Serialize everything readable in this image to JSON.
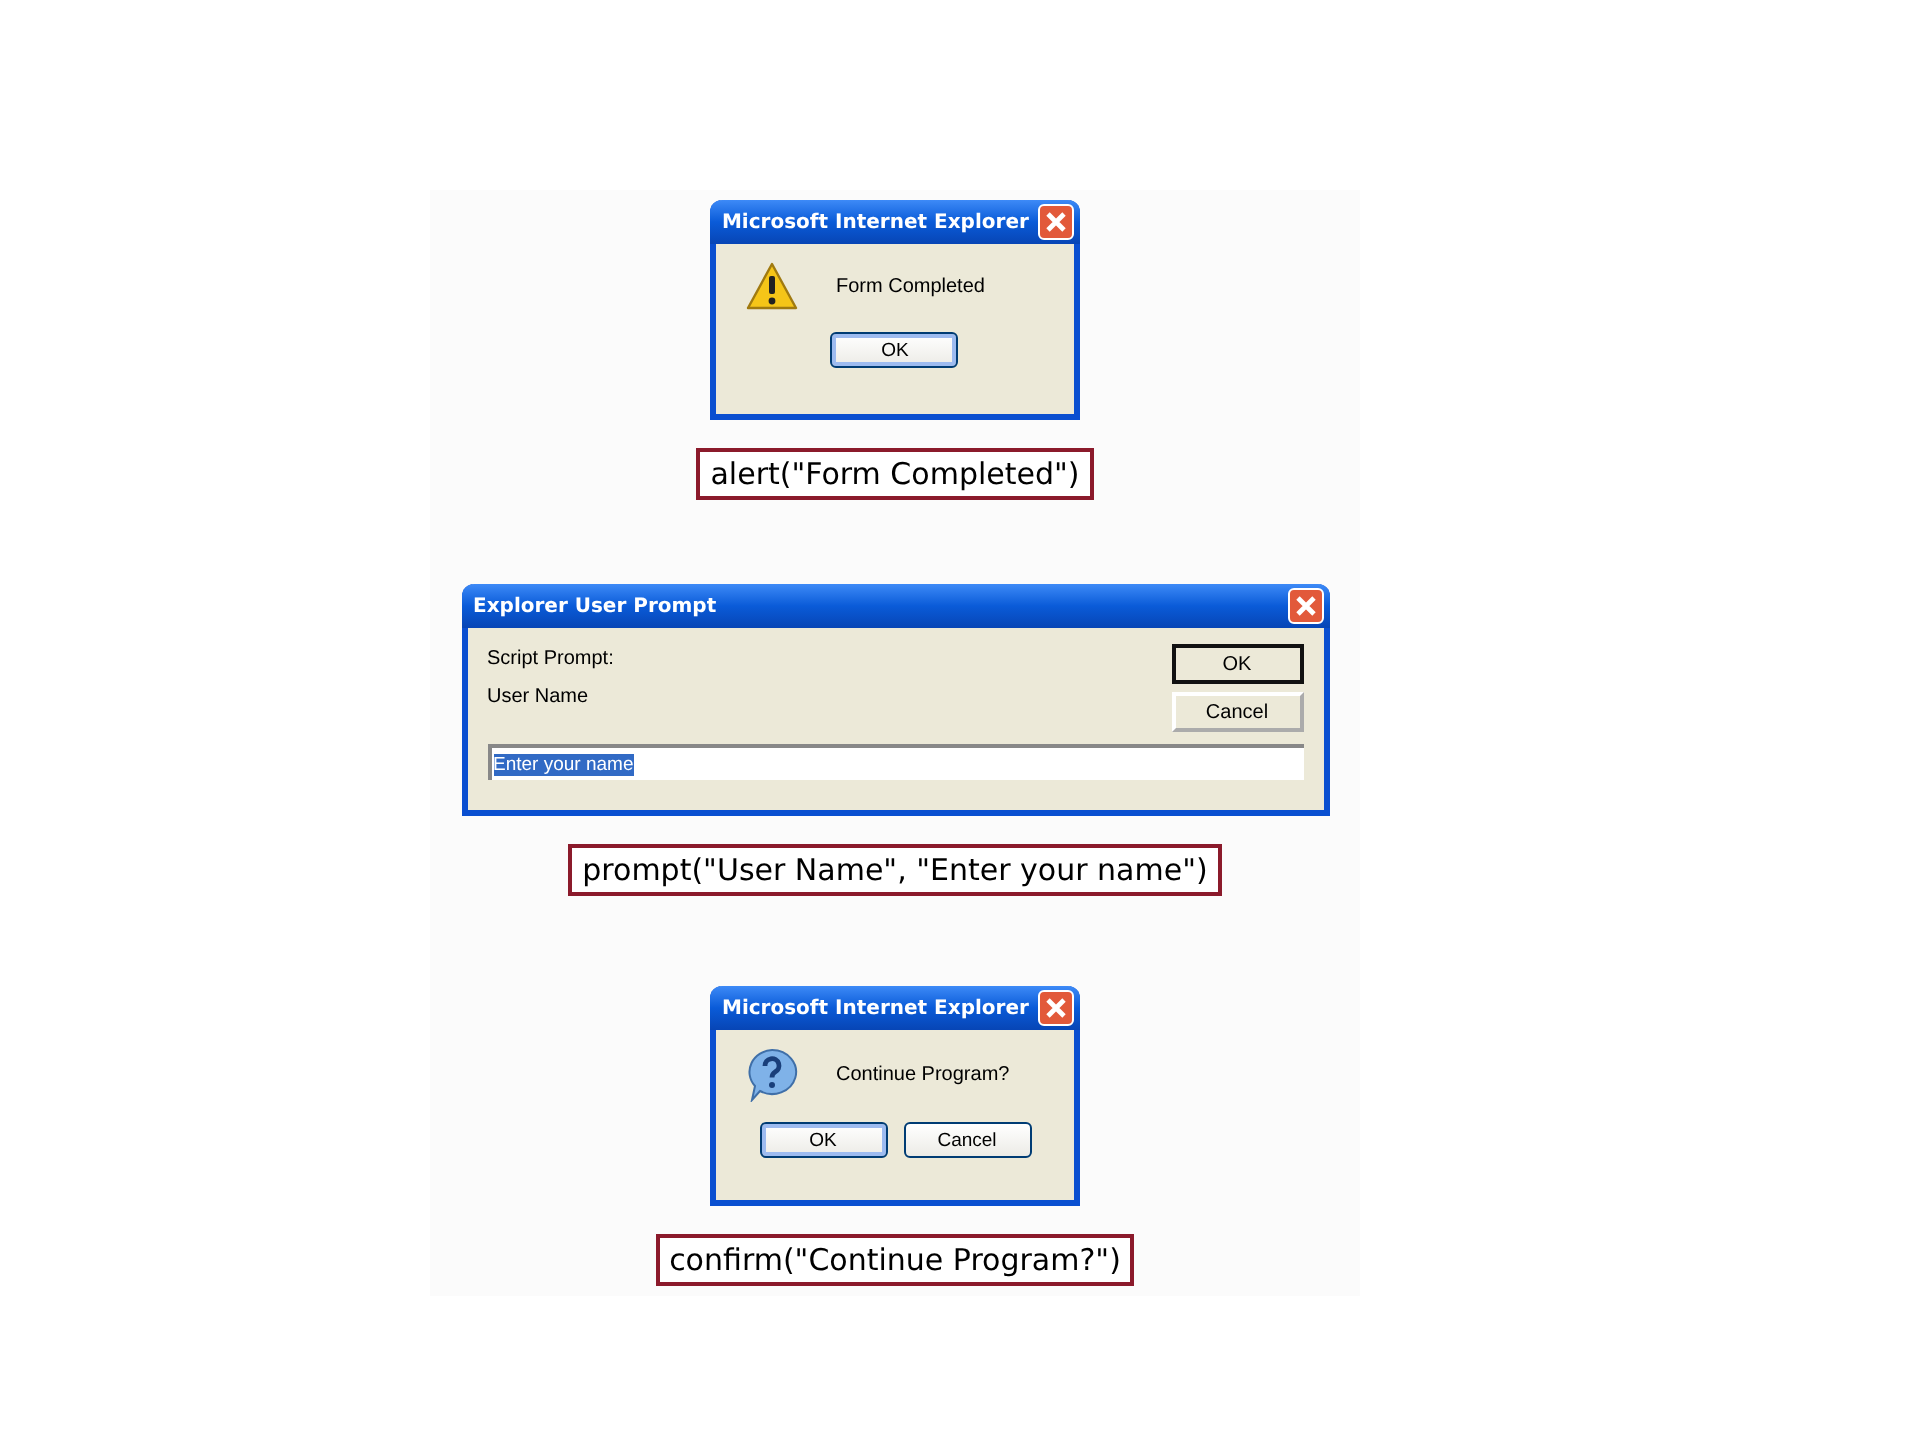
{
  "dialogs": [
    {
      "kind": "alert",
      "title": "Microsoft Internet Explorer",
      "message": "Form Completed",
      "buttons": [
        {
          "label": "OK",
          "default": true
        }
      ],
      "caption": "alert(\"Form Completed\")"
    },
    {
      "kind": "prompt",
      "title": "Explorer User Prompt",
      "lines": [
        "Script Prompt:",
        "User Name"
      ],
      "input": {
        "value": "Enter your name",
        "selected": true
      },
      "buttons": [
        {
          "label": "OK",
          "default": true
        },
        {
          "label": "Cancel",
          "default": false
        }
      ],
      "caption": "prompt(\"User Name\", \"Enter your name\")"
    },
    {
      "kind": "confirm",
      "title": "Microsoft Internet Explorer",
      "message": "Continue Program?",
      "buttons": [
        {
          "label": "OK",
          "default": true
        },
        {
          "label": "Cancel",
          "default": false
        }
      ],
      "caption": "confirm(\"Continue Program?\")"
    }
  ]
}
